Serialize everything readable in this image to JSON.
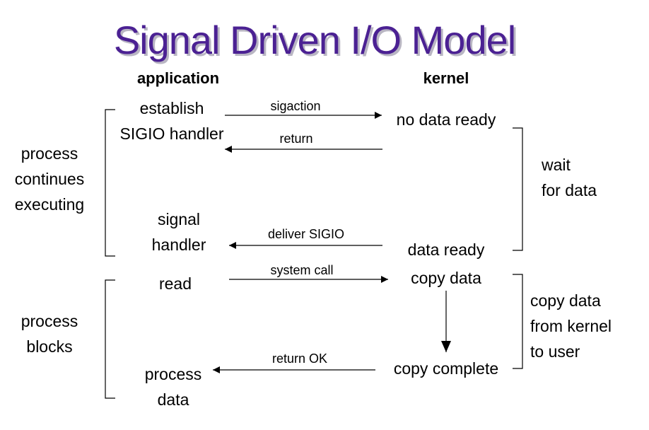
{
  "title": "Signal Driven I/O Model",
  "columns": {
    "application": "application",
    "kernel": "kernel"
  },
  "left_labels": {
    "continues": [
      "process",
      "continues",
      "executing"
    ],
    "blocks": [
      "process",
      "blocks"
    ]
  },
  "application_steps": {
    "establish": [
      "establish",
      "SIGIO handler"
    ],
    "signal_handler": [
      "signal",
      "handler"
    ],
    "read": "read",
    "process_data": [
      "process",
      "data"
    ]
  },
  "kernel_steps": {
    "no_data_ready": "no data ready",
    "data_ready": "data ready",
    "copy_data": "copy data",
    "copy_complete": "copy complete"
  },
  "arrows": {
    "sigaction": "sigaction",
    "return": "return",
    "deliver_sigio": "deliver SIGIO",
    "system_call": "system call",
    "return_ok": "return OK"
  },
  "right_labels": {
    "wait": [
      "wait",
      "for data"
    ],
    "copy": [
      "copy data",
      "from kernel",
      "to user"
    ]
  }
}
